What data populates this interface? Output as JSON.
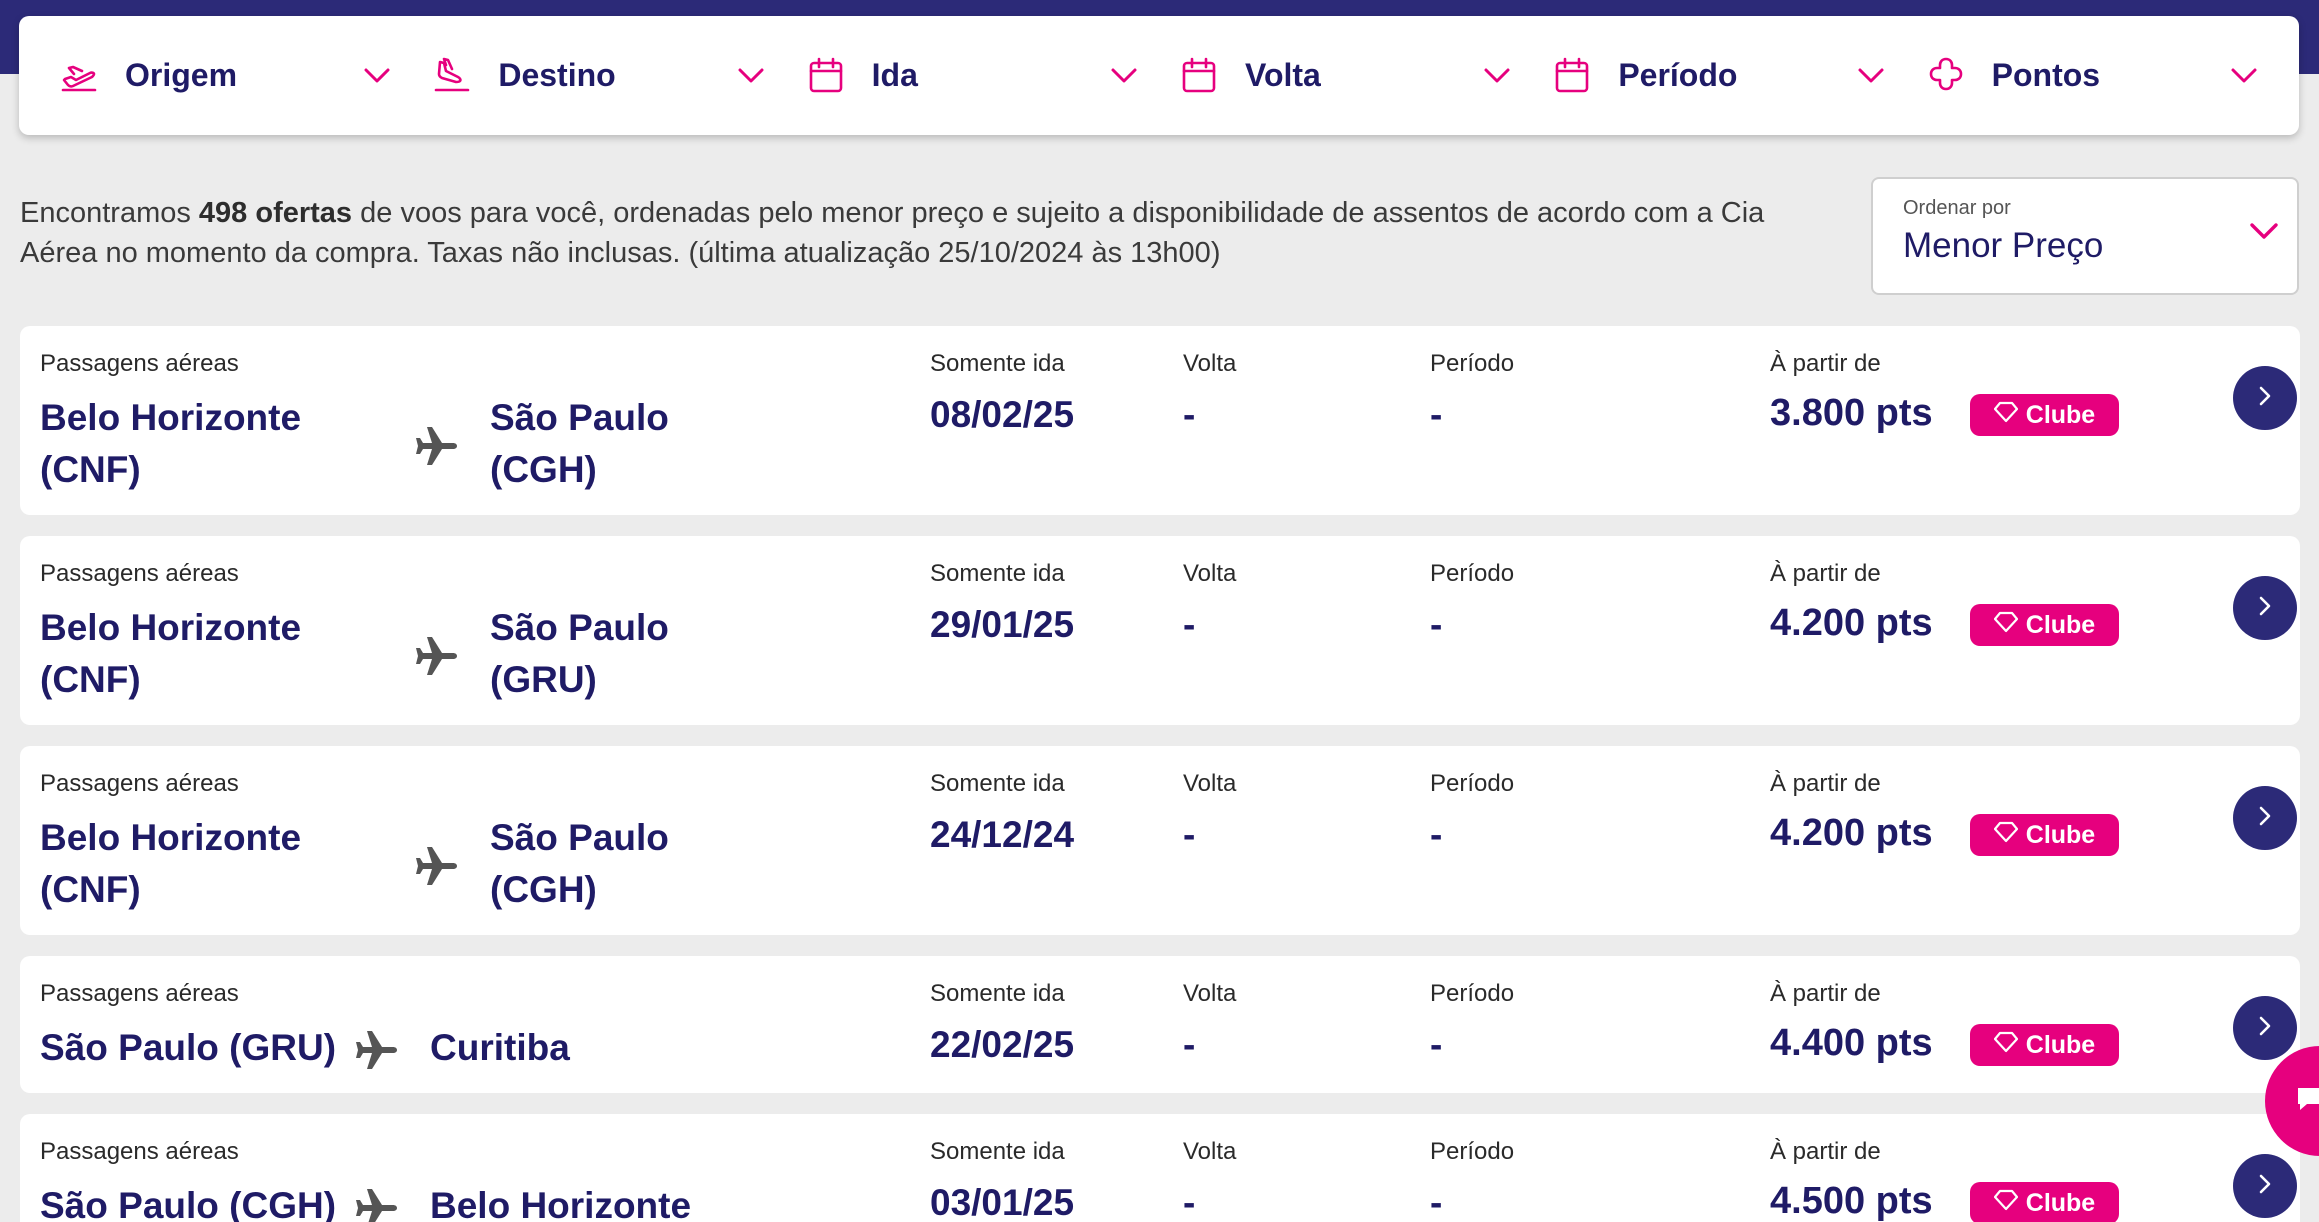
{
  "filters": [
    {
      "label": "Origem",
      "icon": "takeoff-icon"
    },
    {
      "label": "Destino",
      "icon": "landing-icon"
    },
    {
      "label": "Ida",
      "icon": "calendar-icon"
    },
    {
      "label": "Volta",
      "icon": "calendar-icon"
    },
    {
      "label": "Período",
      "icon": "calendar-icon"
    },
    {
      "label": "Pontos",
      "icon": "points-icon"
    }
  ],
  "info": {
    "prefix": "Encontramos ",
    "count": "498 ofertas",
    "suffix": " de voos para você, ordenadas pelo menor preço e sujeito a disponibilidade de assentos de acordo com a Cia Aérea no momento da compra. Taxas não inclusas. (última atualização 25/10/2024 às 13h00)"
  },
  "sort": {
    "label": "Ordenar por",
    "value": "Menor Preço"
  },
  "column_headers": {
    "category": "Passagens aéreas",
    "ida": "Somente ida",
    "volta": "Volta",
    "periodo": "Período",
    "price": "À partir de"
  },
  "offers": [
    {
      "origin": "Belo Horizonte (CNF)",
      "destination": "São Paulo (CGH)",
      "ida": "08/02/25",
      "volta": "-",
      "periodo": "-",
      "price": "3.800 pts",
      "badge": "Clube"
    },
    {
      "origin": "Belo Horizonte (CNF)",
      "destination": "São Paulo (GRU)",
      "ida": "29/01/25",
      "volta": "-",
      "periodo": "-",
      "price": "4.200 pts",
      "badge": "Clube"
    },
    {
      "origin": "Belo Horizonte (CNF)",
      "destination": "São Paulo (CGH)",
      "ida": "24/12/24",
      "volta": "-",
      "periodo": "-",
      "price": "4.200 pts",
      "badge": "Clube"
    },
    {
      "origin": "São Paulo (GRU)",
      "destination": "Curitiba",
      "ida": "22/02/25",
      "volta": "-",
      "periodo": "-",
      "price": "4.400 pts",
      "badge": "Clube"
    },
    {
      "origin": "São Paulo (CGH)",
      "destination": "Belo Horizonte",
      "ida": "03/01/25",
      "volta": "-",
      "periodo": "-",
      "price": "4.500 pts",
      "badge": "Clube"
    }
  ],
  "colors": {
    "brand": "#2c2a78",
    "text": "#1f1b66",
    "accent": "#e6007e"
  }
}
